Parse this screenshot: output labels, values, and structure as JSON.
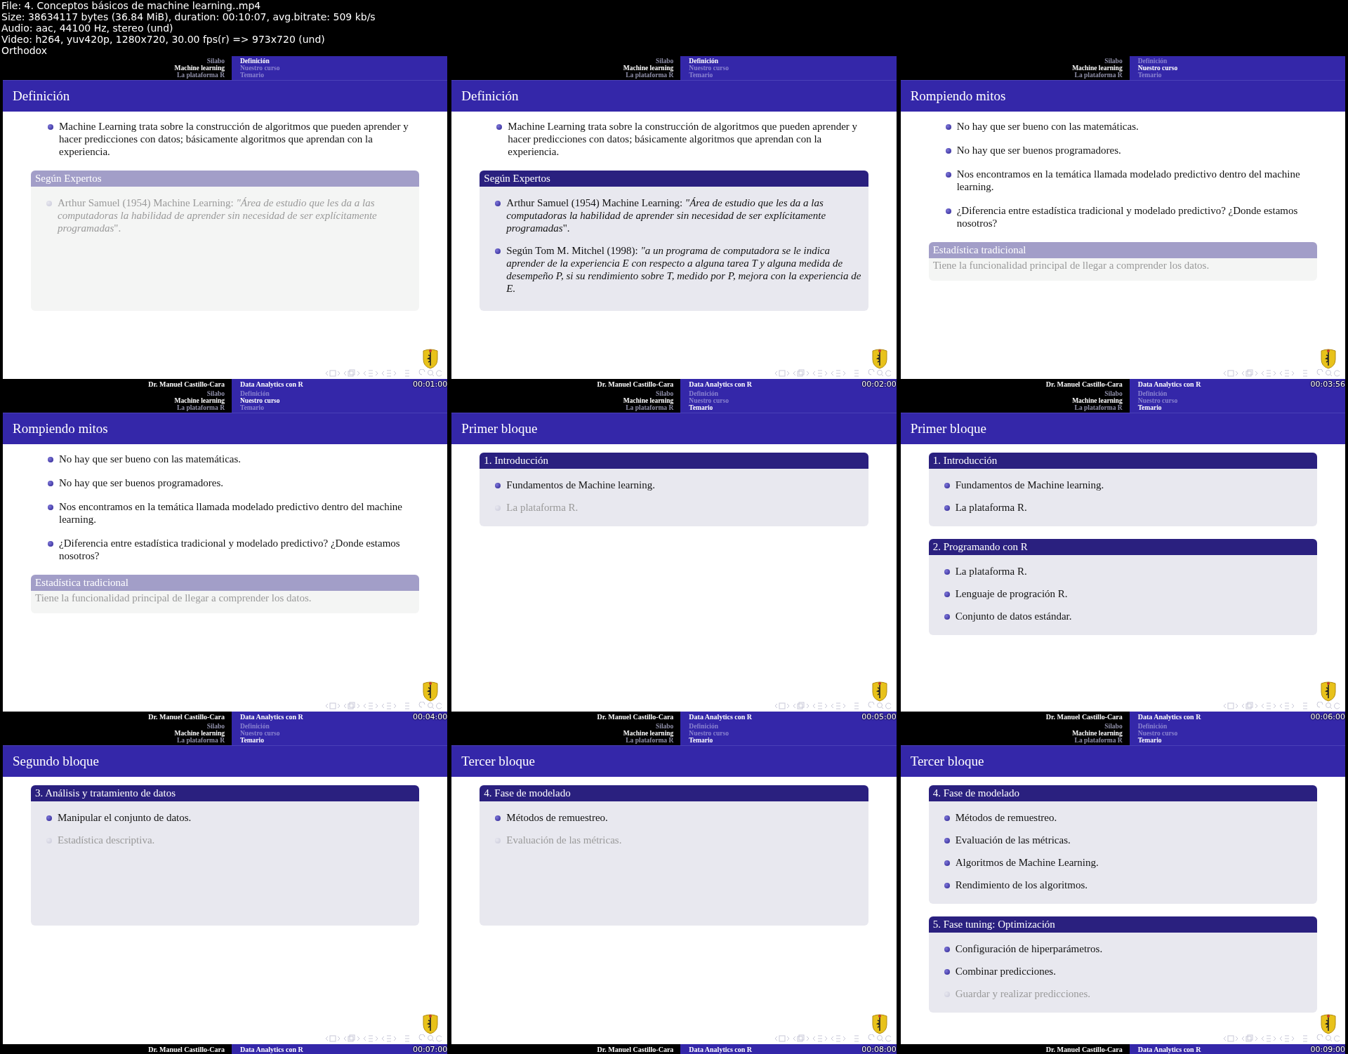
{
  "file_info": [
    "File: 4. Conceptos básicos de machine learning..mp4",
    "Size: 38634117 bytes (36.84 MiB), duration: 00:10:07, avg.bitrate: 509 kb/s",
    "Audio: aac, 44100 Hz, stereo (und)",
    "Video: h264, yuv420p, 1280x720, 30.00 fps(r) => 973x720 (und)",
    "Orthodox"
  ],
  "frames": [
    {
      "nav_left": [
        {
          "label": "Silabo",
          "selected": false
        },
        {
          "label": "Machine learning",
          "selected": true
        },
        {
          "label": "La plataforma R",
          "selected": false
        }
      ],
      "nav_right": [
        {
          "label": "Definición",
          "selected": true
        },
        {
          "label": "Nuestro curso",
          "selected": false
        },
        {
          "label": "Temario",
          "selected": false
        }
      ],
      "title": "Definición",
      "content": [
        {
          "kind": "bullets",
          "items": [
            {
              "text": "Machine Learning trata sobre la construcción de algoritmos que pueden aprender y hacer predicciones con datos; básicamente algoritmos que aprendan con la experiencia.",
              "dim": false
            }
          ]
        },
        {
          "kind": "block",
          "title": "Según Expertos",
          "dim": true,
          "tall": true,
          "items": [
            {
              "text": "Arthur Samuel (1954) Machine Learning: *\"Área de estudio que les da a las computadoras la habilidad de aprender sin necesidad de ser explícitamente programadas*\".",
              "dim": true
            }
          ]
        }
      ],
      "author": "Dr. Manuel Castillo-Cara",
      "course": "Data Analytics con R",
      "timestamp": "00:01:00"
    },
    {
      "nav_left": [
        {
          "label": "Silabo",
          "selected": false
        },
        {
          "label": "Machine learning",
          "selected": true
        },
        {
          "label": "La plataforma R",
          "selected": false
        }
      ],
      "nav_right": [
        {
          "label": "Definición",
          "selected": true
        },
        {
          "label": "Nuestro curso",
          "selected": false
        },
        {
          "label": "Temario",
          "selected": false
        }
      ],
      "title": "Definición",
      "content": [
        {
          "kind": "bullets",
          "items": [
            {
              "text": "Machine Learning trata sobre la construcción de algoritmos que pueden aprender y hacer predicciones con datos; básicamente algoritmos que aprendan con la experiencia.",
              "dim": false
            }
          ]
        },
        {
          "kind": "block",
          "title": "Según Expertos",
          "dim": false,
          "tall": true,
          "items": [
            {
              "text": "Arthur Samuel (1954) Machine Learning: *\"Área de estudio que les da a las computadoras la habilidad de aprender sin necesidad de ser explícitamente programadas*\".",
              "dim": false
            },
            {
              "text": "Según Tom M. Mitchel (1998): *\"a un programa de computadora se le indica aprender de la experiencia E con respecto a alguna tarea T y alguna medida de desempeño P, si su rendimiento sobre T, medido por P, mejora con la experiencia de E.*",
              "dim": false
            }
          ]
        }
      ],
      "author": "Dr. Manuel Castillo-Cara",
      "course": "Data Analytics con R",
      "timestamp": "00:02:00"
    },
    {
      "nav_left": [
        {
          "label": "Silabo",
          "selected": false
        },
        {
          "label": "Machine learning",
          "selected": true
        },
        {
          "label": "La plataforma R",
          "selected": false
        }
      ],
      "nav_right": [
        {
          "label": "Definición",
          "selected": false
        },
        {
          "label": "Nuestro curso",
          "selected": true
        },
        {
          "label": "Temario",
          "selected": false
        }
      ],
      "title": "Rompiendo mitos",
      "content": [
        {
          "kind": "bullets",
          "items": [
            {
              "text": "No hay que ser bueno con las matemáticas.",
              "dim": false
            },
            {
              "text": "No hay que ser buenos programadores.",
              "dim": false
            },
            {
              "text": "Nos encontramos en la temática llamada modelado predictivo dentro del machine learning.",
              "dim": false
            },
            {
              "text": "¿Diferencia entre estadística tradicional y modelado predictivo? ¿Donde estamos nosotros?",
              "dim": false
            }
          ]
        },
        {
          "kind": "block",
          "title": "Estadística tradicional",
          "dim": true,
          "tall": false,
          "text": "Tiene la funcionalidad principal de llegar a comprender los datos."
        }
      ],
      "author": "Dr. Manuel Castillo-Cara",
      "course": "Data Analytics con R",
      "timestamp": "00:03:56"
    },
    {
      "nav_left": [
        {
          "label": "Silabo",
          "selected": false
        },
        {
          "label": "Machine learning",
          "selected": true
        },
        {
          "label": "La plataforma R",
          "selected": false
        }
      ],
      "nav_right": [
        {
          "label": "Definición",
          "selected": false
        },
        {
          "label": "Nuestro curso",
          "selected": true
        },
        {
          "label": "Temario",
          "selected": false
        }
      ],
      "title": "Rompiendo mitos",
      "content": [
        {
          "kind": "bullets",
          "items": [
            {
              "text": "No hay que ser bueno con las matemáticas.",
              "dim": false
            },
            {
              "text": "No hay que ser buenos programadores.",
              "dim": false
            },
            {
              "text": "Nos encontramos en la temática llamada modelado predictivo dentro del machine learning.",
              "dim": false
            },
            {
              "text": "¿Diferencia entre estadística tradicional y modelado predictivo? ¿Donde estamos nosotros?",
              "dim": false
            }
          ]
        },
        {
          "kind": "block",
          "title": "Estadística tradicional",
          "dim": true,
          "tall": false,
          "text": "Tiene la funcionalidad principal de llegar a comprender los datos."
        }
      ],
      "author": "Dr. Manuel Castillo-Cara",
      "course": "Data Analytics con R",
      "timestamp": "00:04:00"
    },
    {
      "nav_left": [
        {
          "label": "Silabo",
          "selected": false
        },
        {
          "label": "Machine learning",
          "selected": true
        },
        {
          "label": "La plataforma R",
          "selected": false
        }
      ],
      "nav_right": [
        {
          "label": "Definición",
          "selected": false
        },
        {
          "label": "Nuestro curso",
          "selected": false
        },
        {
          "label": "Temario",
          "selected": true
        }
      ],
      "title": "Primer bloque",
      "content": [
        {
          "kind": "block",
          "title": "1. Introducción",
          "dim": false,
          "tall": false,
          "items": [
            {
              "text": "Fundamentos de Machine learning.",
              "dim": false
            },
            {
              "text": "La plataforma R.",
              "dim": true
            }
          ]
        }
      ],
      "author": "Dr. Manuel Castillo-Cara",
      "course": "Data Analytics con R",
      "timestamp": "00:05:00"
    },
    {
      "nav_left": [
        {
          "label": "Silabo",
          "selected": false
        },
        {
          "label": "Machine learning",
          "selected": true
        },
        {
          "label": "La plataforma R",
          "selected": false
        }
      ],
      "nav_right": [
        {
          "label": "Definición",
          "selected": false
        },
        {
          "label": "Nuestro curso",
          "selected": false
        },
        {
          "label": "Temario",
          "selected": true
        }
      ],
      "title": "Primer bloque",
      "content": [
        {
          "kind": "block",
          "title": "1. Introducción",
          "dim": false,
          "tall": false,
          "items": [
            {
              "text": "Fundamentos de Machine learning.",
              "dim": false
            },
            {
              "text": "La plataforma R.",
              "dim": false
            }
          ]
        },
        {
          "kind": "block",
          "title": "2. Programando con R",
          "dim": false,
          "tall": false,
          "items": [
            {
              "text": "La plataforma R.",
              "dim": false
            },
            {
              "text": "Lenguaje de progración R.",
              "dim": false
            },
            {
              "text": "Conjunto de datos estándar.",
              "dim": false
            }
          ]
        }
      ],
      "author": "Dr. Manuel Castillo-Cara",
      "course": "Data Analytics con R",
      "timestamp": "00:06:00"
    },
    {
      "nav_left": [
        {
          "label": "Silabo",
          "selected": false
        },
        {
          "label": "Machine learning",
          "selected": true
        },
        {
          "label": "La plataforma R",
          "selected": false
        }
      ],
      "nav_right": [
        {
          "label": "Definición",
          "selected": false
        },
        {
          "label": "Nuestro curso",
          "selected": false
        },
        {
          "label": "Temario",
          "selected": true
        }
      ],
      "title": "Segundo bloque",
      "content": [
        {
          "kind": "block",
          "title": "3. Análisis y tratamiento de datos",
          "dim": false,
          "tall": true,
          "items": [
            {
              "text": "Manipular el conjunto de datos.",
              "dim": false
            },
            {
              "text": "Estadística descriptiva.",
              "dim": true
            }
          ]
        }
      ],
      "author": "Dr. Manuel Castillo-Cara",
      "course": "Data Analytics con R",
      "timestamp": "00:07:00"
    },
    {
      "nav_left": [
        {
          "label": "Silabo",
          "selected": false
        },
        {
          "label": "Machine learning",
          "selected": true
        },
        {
          "label": "La plataforma R",
          "selected": false
        }
      ],
      "nav_right": [
        {
          "label": "Definición",
          "selected": false
        },
        {
          "label": "Nuestro curso",
          "selected": false
        },
        {
          "label": "Temario",
          "selected": true
        }
      ],
      "title": "Tercer bloque",
      "content": [
        {
          "kind": "block",
          "title": "4. Fase de modelado",
          "dim": false,
          "tall": true,
          "items": [
            {
              "text": "Métodos de remuestreo.",
              "dim": false
            },
            {
              "text": "Evaluación de las métricas.",
              "dim": true
            }
          ]
        }
      ],
      "author": "Dr. Manuel Castillo-Cara",
      "course": "Data Analytics con R",
      "timestamp": "00:08:00"
    },
    {
      "nav_left": [
        {
          "label": "Silabo",
          "selected": false
        },
        {
          "label": "Machine learning",
          "selected": true
        },
        {
          "label": "La plataforma R",
          "selected": false
        }
      ],
      "nav_right": [
        {
          "label": "Definición",
          "selected": false
        },
        {
          "label": "Nuestro curso",
          "selected": false
        },
        {
          "label": "Temario",
          "selected": true
        }
      ],
      "title": "Tercer bloque",
      "content": [
        {
          "kind": "block",
          "title": "4. Fase de modelado",
          "dim": false,
          "tall": false,
          "items": [
            {
              "text": "Métodos de remuestreo.",
              "dim": false
            },
            {
              "text": "Evaluación de las métricas.",
              "dim": false
            },
            {
              "text": "Algoritmos de Machine Learning.",
              "dim": false
            },
            {
              "text": "Rendimiento de los algoritmos.",
              "dim": false
            }
          ]
        },
        {
          "kind": "block",
          "title": "5. Fase tuning: Optimización",
          "dim": false,
          "tall": false,
          "items": [
            {
              "text": "Configuración de hiperparámetros.",
              "dim": false
            },
            {
              "text": "Combinar predicciones.",
              "dim": false
            },
            {
              "text": "Guardar y realizar predicciones.",
              "dim": true
            }
          ]
        }
      ],
      "author": "Dr. Manuel Castillo-Cara",
      "course": "Data Analytics con R",
      "timestamp": "00:09:00"
    }
  ]
}
